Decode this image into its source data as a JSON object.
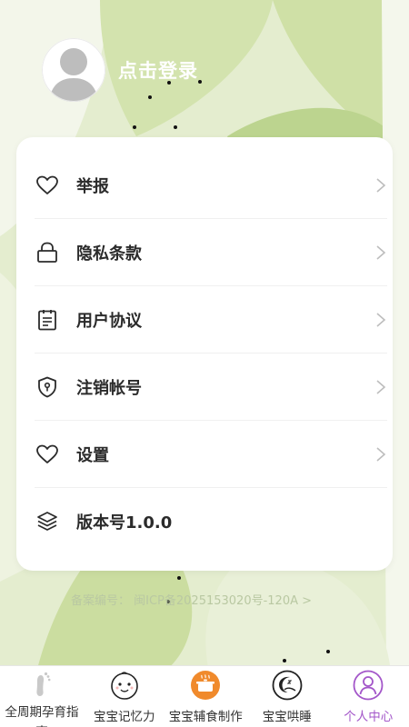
{
  "profile": {
    "login_text": "点击登录"
  },
  "menu": {
    "items": [
      {
        "name": "report",
        "label": "举报",
        "icon": "heart-icon"
      },
      {
        "name": "privacy",
        "label": "隐私条款",
        "icon": "lock-icon"
      },
      {
        "name": "agreement",
        "label": "用户协议",
        "icon": "document-icon"
      },
      {
        "name": "cancel-account",
        "label": "注销帐号",
        "icon": "shield-icon"
      },
      {
        "name": "settings",
        "label": "设置",
        "icon": "heart-icon"
      },
      {
        "name": "version",
        "label": "版本号1.0.0",
        "icon": "layers-icon"
      }
    ]
  },
  "footer": {
    "icp_text": "备案编号：   闽ICP备2025153020号-120A >"
  },
  "tabbar": {
    "tabs": [
      {
        "label": "全周期孕育指南",
        "icon": "footprint-icon"
      },
      {
        "label": "宝宝记忆力",
        "icon": "baby-face-icon"
      },
      {
        "label": "宝宝辅食制作",
        "icon": "cooking-pot-icon"
      },
      {
        "label": "宝宝哄睡",
        "icon": "sleeping-moon-icon"
      },
      {
        "label": "个人中心",
        "icon": "user-icon"
      }
    ],
    "active_index": 4
  },
  "colors": {
    "accent": "#a356c9",
    "background": "#dfe9c8",
    "orange": "#f08a2c"
  }
}
